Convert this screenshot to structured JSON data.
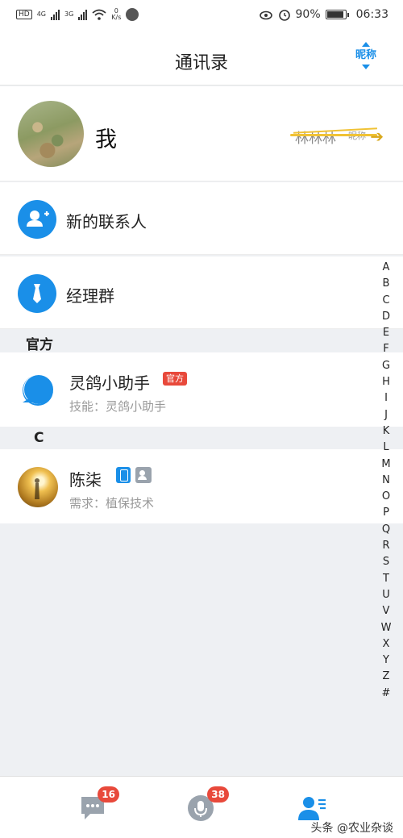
{
  "status_bar": {
    "network_speed_value": "0",
    "network_speed_unit": "K/s",
    "sig1_label": "4G",
    "sig2_label": "3G",
    "battery": "90%",
    "time": "06:33"
  },
  "header": {
    "title": "通讯录",
    "sort_label": "昵称"
  },
  "me": {
    "name": "我",
    "nickname": "林林林",
    "nickname_tag": "昵称"
  },
  "actions": [
    {
      "label": "新的联系人",
      "icon": "add-contact-icon"
    },
    {
      "label": "经理群",
      "icon": "tie-icon"
    }
  ],
  "sections": [
    {
      "title": "官方",
      "contacts": [
        {
          "name": "灵鸽小助手",
          "badge": "官方",
          "subtitle": "技能：灵鸽小助手"
        }
      ]
    },
    {
      "title": "C",
      "contacts": [
        {
          "name": "陈柒",
          "subtitle": "需求：植保技术",
          "icons": [
            "phone-icon",
            "contact-card-icon"
          ]
        }
      ]
    }
  ],
  "index_letters": [
    "A",
    "B",
    "C",
    "D",
    "E",
    "F",
    "G",
    "H",
    "I",
    "J",
    "K",
    "L",
    "M",
    "N",
    "O",
    "P",
    "Q",
    "R",
    "S",
    "T",
    "U",
    "V",
    "W",
    "X",
    "Y",
    "Z",
    "#"
  ],
  "tabbar": {
    "messages_badge": "16",
    "voice_badge": "38"
  },
  "watermark": "头条 @农业杂谈",
  "colors": {
    "accent": "#1a8fe8",
    "badge": "#e8493b",
    "background": "#eef0f3"
  }
}
